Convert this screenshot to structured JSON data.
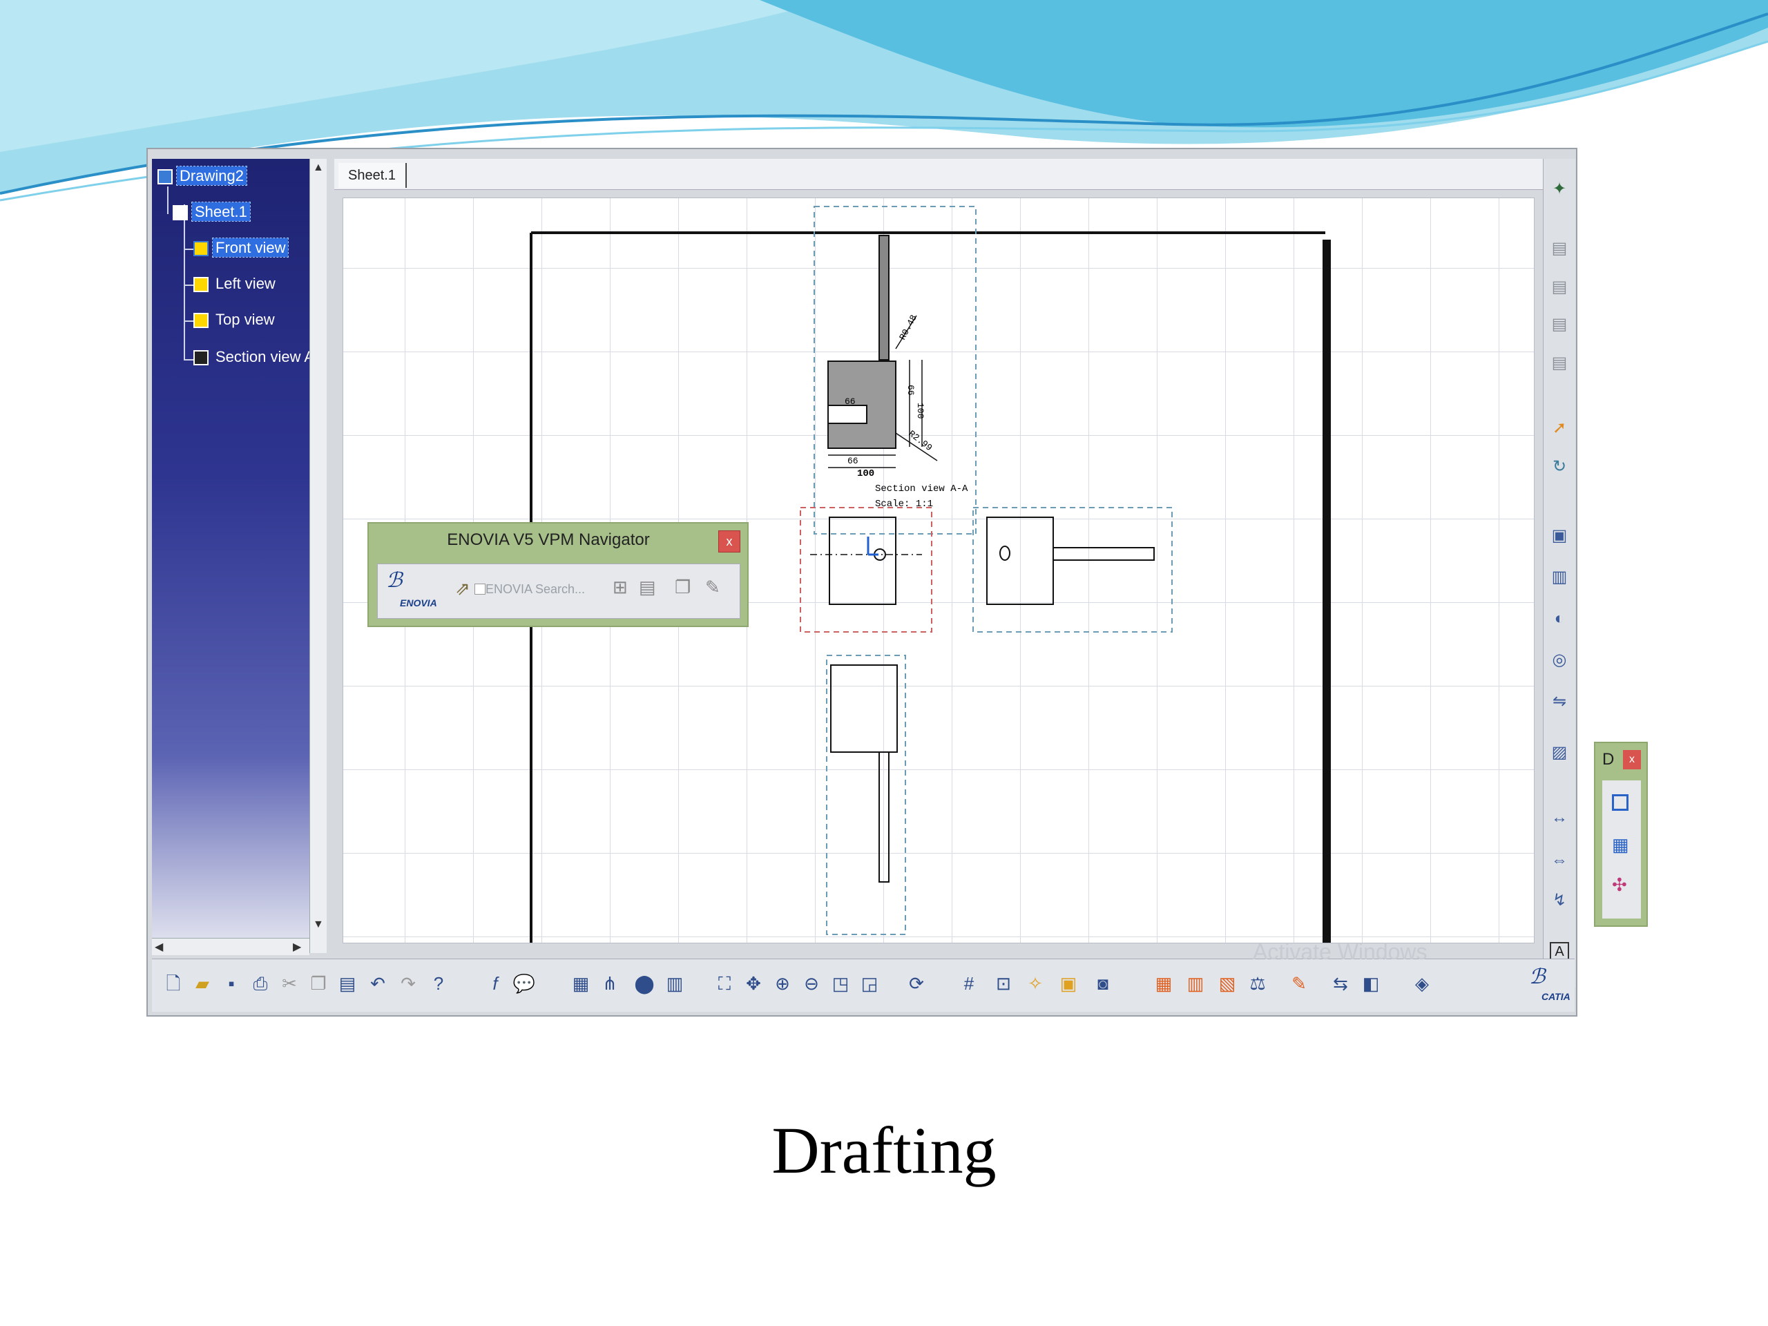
{
  "app": {
    "tree": {
      "items": [
        {
          "label": "Drawing2",
          "selected": true
        },
        {
          "label": "Sheet.1",
          "selected": true
        },
        {
          "label": "Front view",
          "selected": true
        },
        {
          "label": "Left view",
          "selected": false
        },
        {
          "label": "Top view",
          "selected": false
        },
        {
          "label": "Section view A",
          "selected": false
        }
      ]
    },
    "tabs": [
      {
        "label": "Sheet.1"
      }
    ],
    "drawing": {
      "section_caption_line1": "Section view A-A",
      "section_caption_line2": "Scale:  1:1",
      "dims": [
        "R0.48",
        "66",
        "100",
        "66",
        "100",
        "66",
        "R2.99",
        "100"
      ]
    },
    "enovia_toolbar": {
      "title": "ENOVIA V5 VPM Navigator",
      "close": "x",
      "logo_text": "ENOVIA",
      "search_placeholder": "ENOVIA Search..."
    },
    "floating_toolbar": {
      "title": "D",
      "close": "x"
    },
    "watermark": "Activate Windows",
    "catia_logo": "CATIA"
  },
  "slide": {
    "caption": "Drafting"
  },
  "colors": {
    "banner_light": "#a8e0ef",
    "banner_dark": "#3aaed8",
    "toolbar_green": "#a7c08a",
    "tree_bg": "#2e3590",
    "selection": "#2f6ee0"
  }
}
